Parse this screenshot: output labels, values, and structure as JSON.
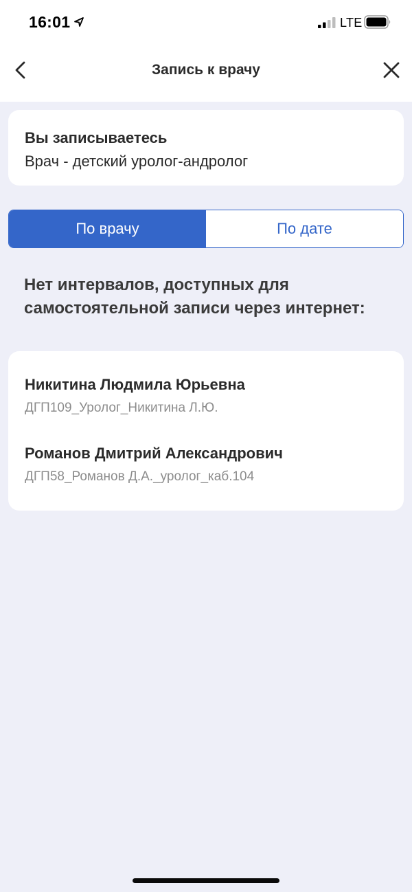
{
  "status_bar": {
    "time": "16:01",
    "network": "LTE",
    "icons": [
      "location-arrow-icon",
      "signal-icon",
      "battery-icon"
    ]
  },
  "nav": {
    "title": "Запись к врачу",
    "icons": [
      "chevron-left-icon",
      "close-icon"
    ]
  },
  "appointment": {
    "label": "Вы записываетесь",
    "value": "Врач - детский уролог-андролог"
  },
  "segment": {
    "by_doctor": "По врачу",
    "by_date": "По дате",
    "selected": "by_doctor"
  },
  "info_heading": "Нет интервалов, доступных для самостоятельной записи через интернет:",
  "doctors": [
    {
      "name": "Никитина Людмила Юрьевна",
      "code": "ДГП109_Уролог_Никитина Л.Ю."
    },
    {
      "name": "Романов Дмитрий Александрович",
      "code": "ДГП58_Романов Д.А._уролог_каб.104"
    }
  ],
  "colors": {
    "accent": "#3466c9",
    "background": "#eeeff8",
    "card": "#ffffff",
    "secondary_text": "#8c8c8c"
  }
}
